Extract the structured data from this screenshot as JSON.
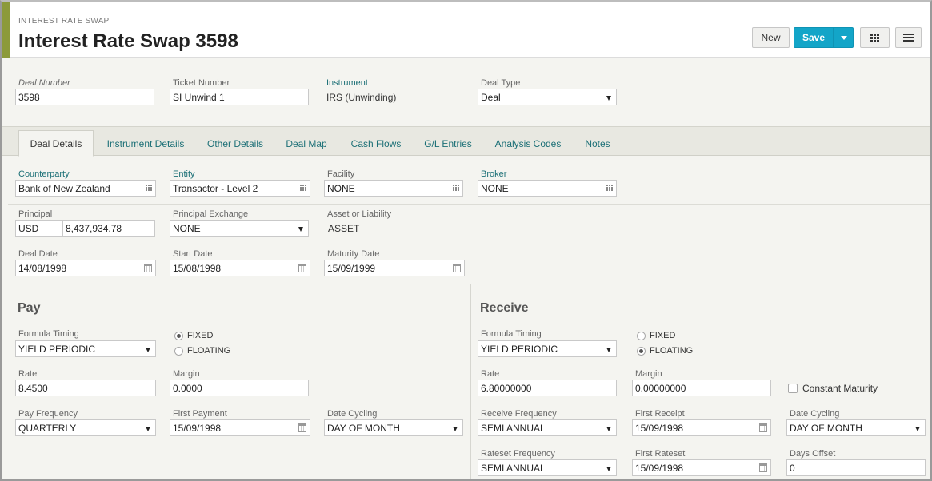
{
  "header": {
    "kicker": "INTEREST RATE SWAP",
    "title": "Interest Rate Swap 3598",
    "new_label": "New",
    "save_label": "Save",
    "accent_color": "#8c9a3a",
    "save_color": "#13a5c8"
  },
  "deal": {
    "deal_number_label": "Deal Number",
    "deal_number": "3598",
    "ticket_number_label": "Ticket Number",
    "ticket_number": "SI Unwind 1",
    "instrument_label": "Instrument",
    "instrument": "IRS (Unwinding)",
    "deal_type_label": "Deal Type",
    "deal_type": "Deal"
  },
  "tabs": [
    {
      "label": "Deal Details"
    },
    {
      "label": "Instrument Details"
    },
    {
      "label": "Other Details"
    },
    {
      "label": "Deal Map"
    },
    {
      "label": "Cash Flows"
    },
    {
      "label": "G/L Entries"
    },
    {
      "label": "Analysis Codes"
    },
    {
      "label": "Notes"
    }
  ],
  "details": {
    "counterparty_label": "Counterparty",
    "counterparty": "Bank of New Zealand",
    "entity_label": "Entity",
    "entity": "Transactor - Level 2",
    "facility_label": "Facility",
    "facility": "NONE",
    "broker_label": "Broker",
    "broker": "NONE",
    "principal_label": "Principal",
    "principal_currency": "USD",
    "principal_amount": "8,437,934.78",
    "principal_exchange_label": "Principal Exchange",
    "principal_exchange": "NONE",
    "asset_liability_label": "Asset or Liability",
    "asset_liability": "ASSET",
    "deal_date_label": "Deal Date",
    "deal_date": "14/08/1998",
    "start_date_label": "Start Date",
    "start_date": "15/08/1998",
    "maturity_date_label": "Maturity Date",
    "maturity_date": "15/09/1999"
  },
  "pay": {
    "title": "Pay",
    "formula_timing_label": "Formula Timing",
    "formula_timing": "YIELD PERIODIC",
    "fixed_label": "FIXED",
    "floating_label": "FLOATING",
    "selected": "FIXED",
    "rate_label": "Rate",
    "rate": "8.4500",
    "margin_label": "Margin",
    "margin": "0.0000",
    "frequency_label": "Pay Frequency",
    "frequency": "QUARTERLY",
    "first_payment_label": "First Payment",
    "first_payment": "15/09/1998",
    "date_cycling_label": "Date Cycling",
    "date_cycling": "DAY OF MONTH"
  },
  "receive": {
    "title": "Receive",
    "formula_timing_label": "Formula Timing",
    "formula_timing": "YIELD PERIODIC",
    "fixed_label": "FIXED",
    "floating_label": "FLOATING",
    "selected": "FLOATING",
    "rate_label": "Rate",
    "rate": "6.80000000",
    "margin_label": "Margin",
    "margin": "0.00000000",
    "constant_maturity_label": "Constant Maturity",
    "frequency_label": "Receive Frequency",
    "frequency": "SEMI ANNUAL",
    "first_receipt_label": "First Receipt",
    "first_receipt": "15/09/1998",
    "date_cycling_label": "Date Cycling",
    "date_cycling": "DAY OF MONTH",
    "rateset_frequency_label": "Rateset Frequency",
    "rateset_frequency": "SEMI ANNUAL",
    "first_rateset_label": "First Rateset",
    "first_rateset": "15/09/1998",
    "days_offset_label": "Days Offset",
    "days_offset": "0"
  }
}
